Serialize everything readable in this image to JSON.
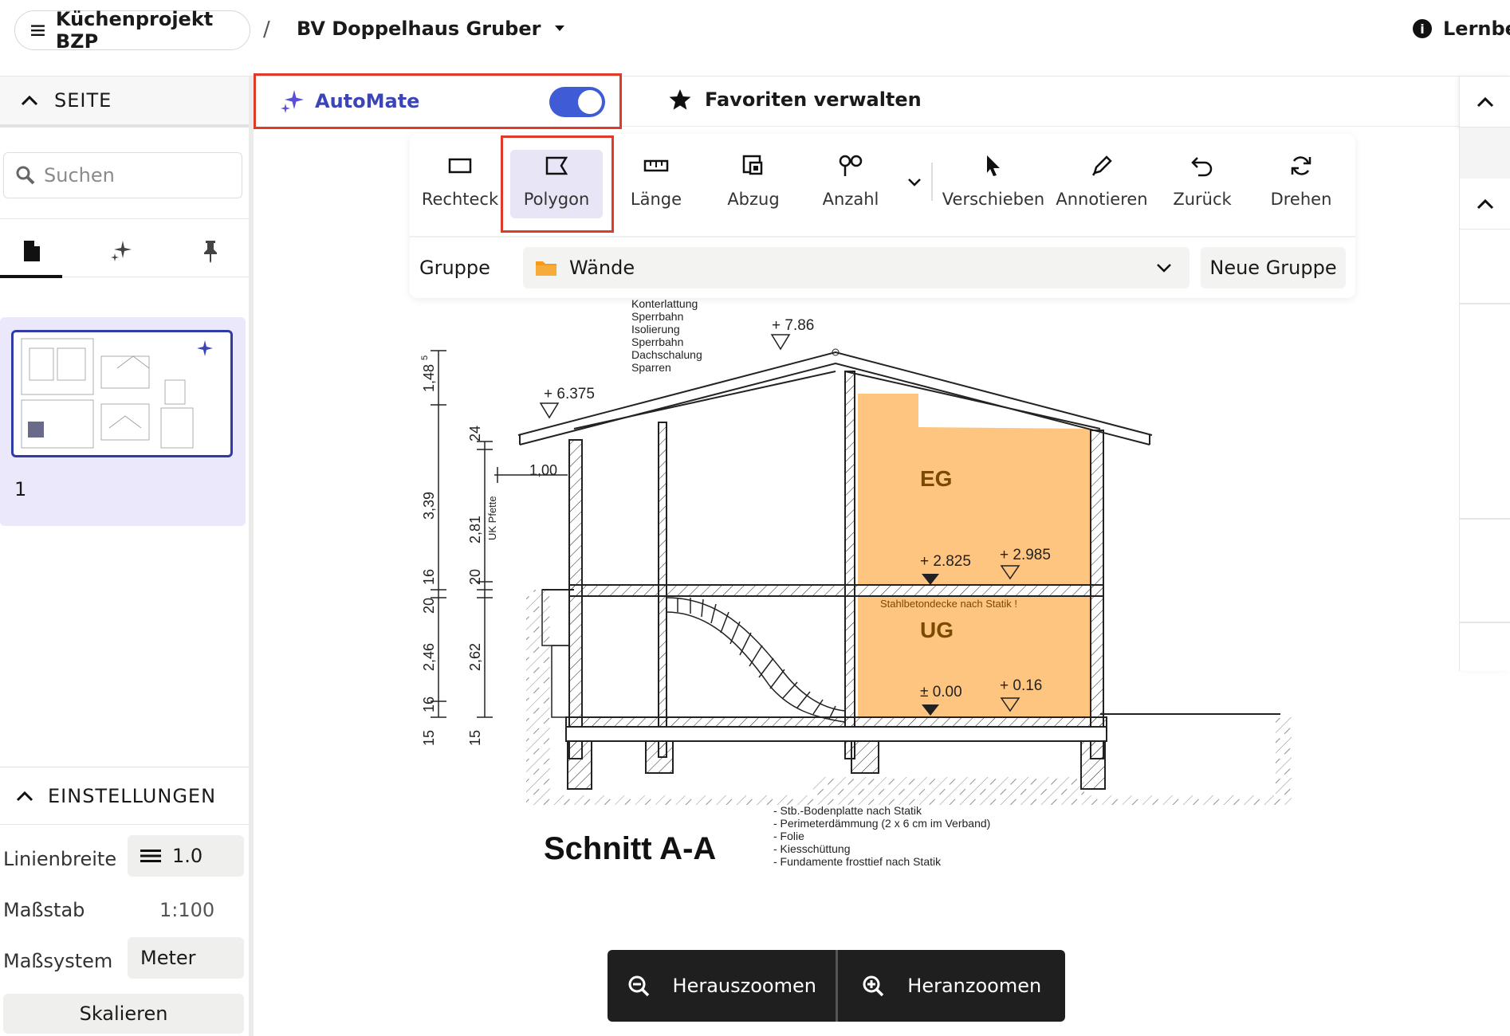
{
  "topbar": {
    "menu_icon": "hamburger-icon",
    "project": "Küchenprojekt BZP",
    "separator": "/",
    "document": "BV Doppelhaus Gruber",
    "learn": "Lernber"
  },
  "sidebar": {
    "section_title": "SEITE",
    "search_placeholder": "Suchen",
    "page_number": "1",
    "settings_title": "EINSTELLUNGEN",
    "settings": {
      "line_width_label": "Linienbreite",
      "line_width_value": "1.0",
      "scale_label": "Maßstab",
      "scale_value": "1:100",
      "system_label": "Maßsystem",
      "system_value": "Meter",
      "scale_button": "Skalieren"
    }
  },
  "subbar": {
    "automate_label": "AutoMate",
    "automate_enabled": true,
    "favorites_label": "Favoriten verwalten"
  },
  "toolbar": {
    "tools": [
      "Rechteck",
      "Polygon",
      "Länge",
      "Abzug",
      "Anzahl",
      "Verschieben",
      "Annotieren",
      "Zurück",
      "Drehen"
    ],
    "active_tool": "Polygon",
    "group_label": "Gruppe",
    "group_value": "Wände",
    "new_group": "Neue Gruppe"
  },
  "drawing": {
    "title": "Schnitt A-A",
    "layers": [
      "Konterlattung",
      "Sperrbahn",
      "Isolierung",
      "Sperrbahn",
      "Dachschalung",
      "Sparren"
    ],
    "levels": {
      "ridge": "+ 7.86",
      "eave": "+ 6.375",
      "eg": "+ 2.825",
      "eg2": "+ 2.985",
      "ug": "± 0.00",
      "ug2": "+ 0.16"
    },
    "rooms": {
      "upper": "EG",
      "lower": "UG"
    },
    "slab_note": "Stahlbetondecke nach Statik !",
    "dims": {
      "a": "1,48",
      "a_sup": "5",
      "b": "3,39",
      "c": "24",
      "d": "2,81",
      "e": "UK Pfette",
      "f": "16",
      "g": "20",
      "h": "20",
      "i": "2,46",
      "i_sup": "5",
      "j": "2,62",
      "j_sup": "5",
      "k": "16",
      "l": "15",
      "m": "15",
      "n": "1,00"
    },
    "notes": [
      "- Stb.-Bodenplatte nach Statik",
      "- Perimeterdämmung (2 x 6 cm im Verband)",
      "- Folie",
      "- Kiesschüttung",
      "- Fundamente frosttief nach Statik"
    ],
    "highlight_color": "#fdc57f"
  },
  "zoom": {
    "out": "Herauszoomen",
    "in": "Heranzoomen"
  }
}
